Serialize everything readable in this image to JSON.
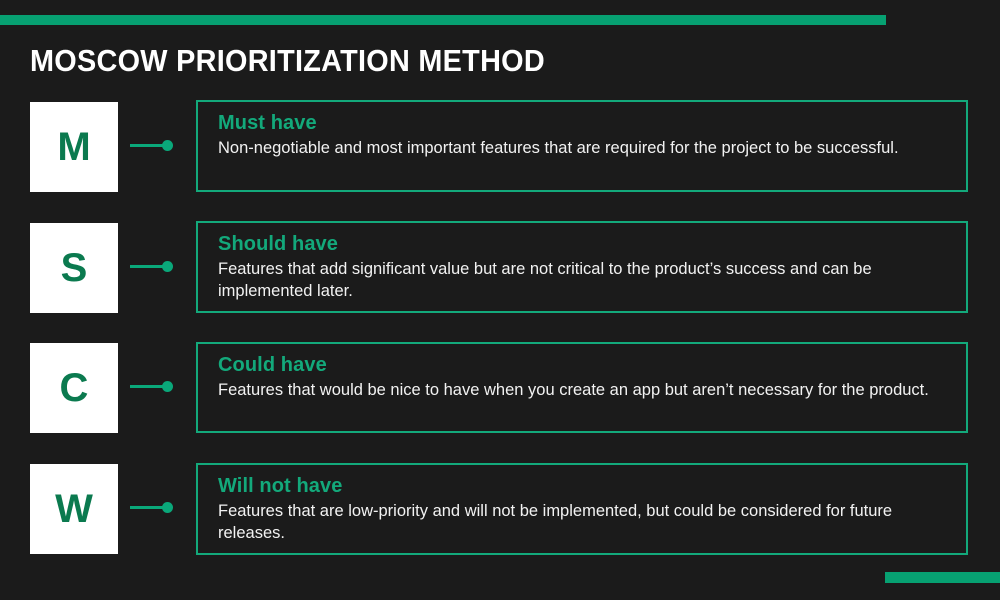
{
  "slide": {
    "title": "MOSCOW PRIORITIZATION METHOD",
    "background_color": "#1b1b1b",
    "accent_color": "#07a172",
    "border_color": "#13a97b",
    "letter_color": "#0b7a4f",
    "body_text_color": "#f2f2f2"
  },
  "decor": {
    "top_bar_label": "top-accent-bar",
    "bottom_bar_label": "bottom-accent-bar"
  },
  "items": [
    {
      "letter": "M",
      "title": "Must have",
      "body": "Non-negotiable and most important features that are required for the project to be successful."
    },
    {
      "letter": "S",
      "title": "Should have",
      "body": "Features that add significant value but are not critical to the product’s success and can be implemented later."
    },
    {
      "letter": "C",
      "title": "Could have",
      "body": "Features that would be nice to have when you create an app but aren’t necessary for the product."
    },
    {
      "letter": "W",
      "title": "Will not have",
      "body": "Features that are low-priority and will not be implemented, but could be considered for future releases."
    }
  ]
}
